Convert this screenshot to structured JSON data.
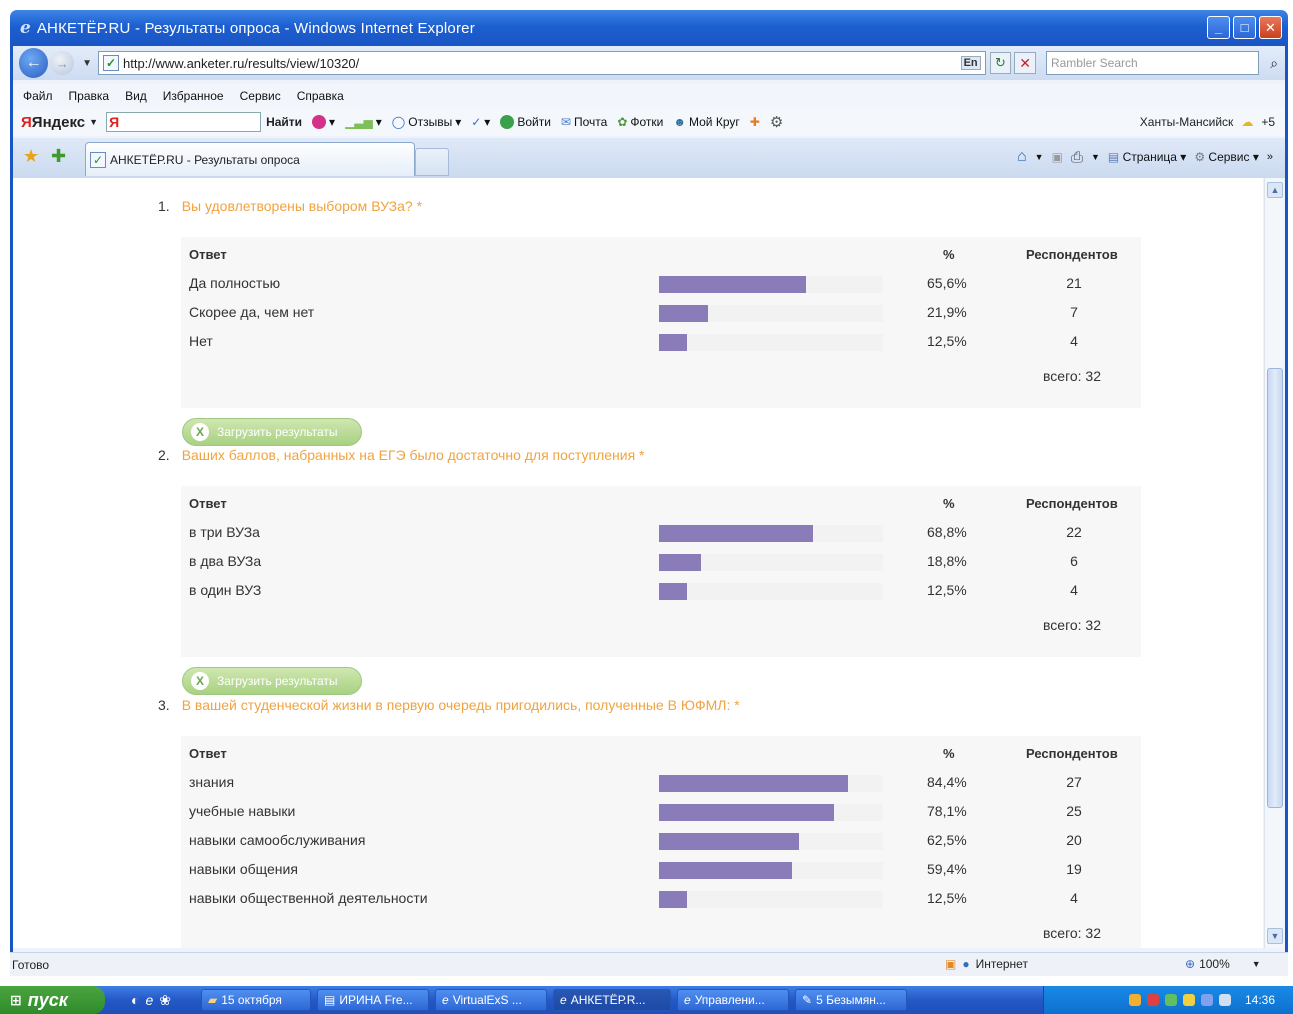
{
  "window": {
    "title": "АНКЕТЁР.RU - Результаты опроса - Windows Internet Explorer"
  },
  "address": {
    "url": "http://www.anketer.ru/results/view/10320/",
    "search_placeholder": "Rambler Search",
    "lang": "En"
  },
  "menu": [
    "Файл",
    "Правка",
    "Вид",
    "Избранное",
    "Сервис",
    "Справка"
  ],
  "yandex_bar": {
    "logo": "Яндекс",
    "input_value": "Я",
    "find": "Найти",
    "reviews": "Отзывы",
    "login": "Войти",
    "mail": "Почта",
    "photos": "Фотки",
    "mycircle": "Мой Круг",
    "city": "Ханты-Мансийск",
    "temp": "+5"
  },
  "tab": {
    "label": "АНКЕТЁР.RU - Результаты опроса"
  },
  "cmdbar": {
    "page": "Страница",
    "tools": "Сервис"
  },
  "survey": {
    "headers": {
      "answer": "Ответ",
      "percent": "%",
      "respondents": "Респондентов"
    },
    "download_label": "Загрузить результаты",
    "questions": [
      {
        "num": "1.",
        "text": "Вы удовлетворены выбором ВУЗа? *",
        "rows": [
          {
            "label": "Да полностью",
            "pct": "65,6%",
            "value": 65.6,
            "count": "21"
          },
          {
            "label": "Скорее да, чем нет",
            "pct": "21,9%",
            "value": 21.9,
            "count": "7"
          },
          {
            "label": "Нет",
            "pct": "12,5%",
            "value": 12.5,
            "count": "4"
          }
        ],
        "total": "всего: 32"
      },
      {
        "num": "2.",
        "text": "Ваших баллов, набранных на ЕГЭ было достаточно для поступления *",
        "rows": [
          {
            "label": "в три ВУЗа",
            "pct": "68,8%",
            "value": 68.8,
            "count": "22"
          },
          {
            "label": "в два ВУЗа",
            "pct": "18,8%",
            "value": 18.8,
            "count": "6"
          },
          {
            "label": "в один ВУЗ",
            "pct": "12,5%",
            "value": 12.5,
            "count": "4"
          }
        ],
        "total": "всего: 32"
      },
      {
        "num": "3.",
        "text": "В вашей студенческой жизни в первую очередь пригодились, полученные В ЮФМЛ: *",
        "rows": [
          {
            "label": "знания",
            "pct": "84,4%",
            "value": 84.4,
            "count": "27"
          },
          {
            "label": "учебные навыки",
            "pct": "78,1%",
            "value": 78.1,
            "count": "25"
          },
          {
            "label": "навыки самообслуживания",
            "pct": "62,5%",
            "value": 62.5,
            "count": "20"
          },
          {
            "label": "навыки общения",
            "pct": "59,4%",
            "value": 59.4,
            "count": "19"
          },
          {
            "label": "навыки общественной деятельности",
            "pct": "12,5%",
            "value": 12.5,
            "count": "4"
          }
        ],
        "total": "всего: 32"
      }
    ]
  },
  "statusbar": {
    "status": "Готово",
    "zone": "Интернет",
    "zoom": "100%"
  },
  "taskbar": {
    "start": "пуск",
    "tasks": [
      "15 октября",
      "ИРИНА Fre...",
      "VirtualExS ...",
      "АНКЕТЁР.R...",
      "Управлени...",
      "5 Безымян..."
    ],
    "clock": "14:36"
  },
  "colors": {
    "question_title": "#f0a341",
    "bar_fill": "#8a7cb8",
    "download_button": "#a8d182"
  }
}
